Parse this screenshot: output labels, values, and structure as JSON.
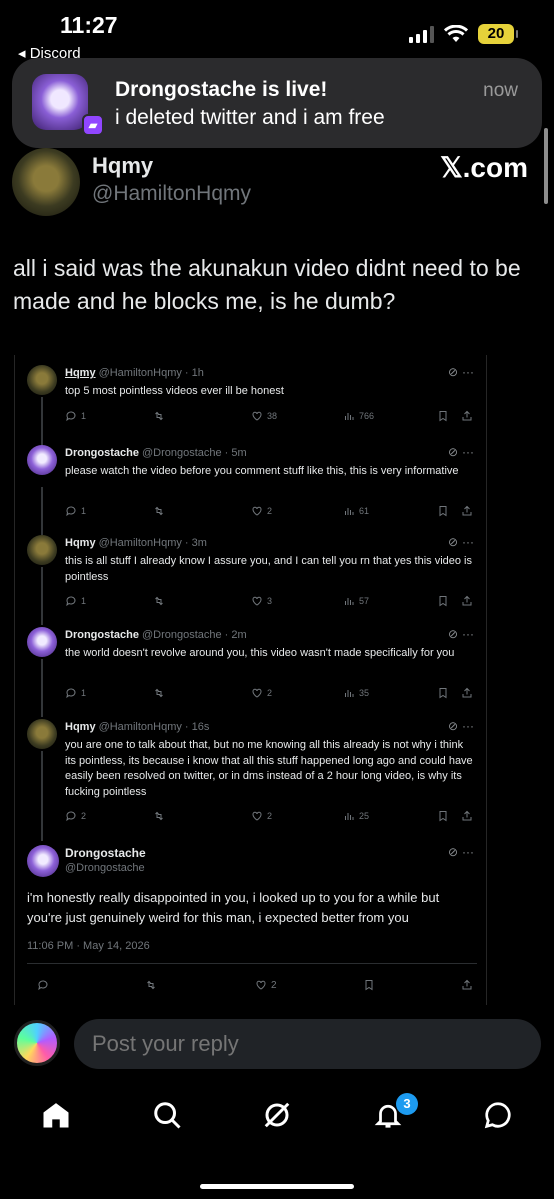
{
  "status_bar": {
    "time": "11:27",
    "back_app": "◂ Discord",
    "battery": "20"
  },
  "notification": {
    "title": "Drongostache is live!",
    "body": "i deleted twitter and i am free",
    "time": "now"
  },
  "post": {
    "author_name": "Hqmy",
    "author_handle": "@HamiltonHqmy",
    "source": "𝕏.com",
    "text": "all i said was the akunakun video didnt need to be made and he blocks me, is he dumb?"
  },
  "embedded_thread": {
    "tweets": [
      {
        "name": "Hqmy",
        "handle": "@HamiltonHqmy · 1h",
        "text": "top 5 most pointless videos ever ill be honest",
        "replies": "1",
        "retweets": "",
        "likes": "38",
        "views": "766"
      },
      {
        "name": "Drongostache",
        "handle": "@Drongostache · 5m",
        "text": "please watch the video before you comment stuff like this, this is very informative",
        "replies": "1",
        "retweets": "",
        "likes": "2",
        "views": "61"
      },
      {
        "name": "Hqmy",
        "handle": "@HamiltonHqmy · 3m",
        "text": "this is all stuff I already know I assure you, and I can tell you rn that yes this video is pointless",
        "replies": "1",
        "retweets": "",
        "likes": "3",
        "views": "57"
      },
      {
        "name": "Drongostache",
        "handle": "@Drongostache · 2m",
        "text": "the world doesn't revolve around you, this video wasn't made specifically for you",
        "replies": "1",
        "retweets": "",
        "likes": "2",
        "views": "35"
      },
      {
        "name": "Hqmy",
        "handle": "@HamiltonHqmy · 16s",
        "text": "you are one to talk about that, but no me knowing all this already is not why i think its pointless, its because i know that all this stuff happened long ago and could have easily been resolved on twitter, or in dms instead of a 2 hour long video, is why its fucking pointless",
        "replies": "2",
        "retweets": "",
        "likes": "2",
        "views": "25"
      }
    ],
    "final_tweet": {
      "name": "Drongostache",
      "handle": "@Drongostache",
      "text": "i'm honestly really disappointed in you, i looked up to you for a while but you're just genuinely weird for this man, i expected better from you",
      "timestamp": "11:06 PM · May 14, 2026",
      "likes": "2"
    }
  },
  "reply_bar": {
    "placeholder": "Post your reply"
  },
  "bottom_nav": {
    "notification_count": "3"
  },
  "colors": {
    "accent": "#1d9bf0",
    "background": "#000000",
    "secondary_text": "#71767b",
    "twitch": "#9146ff",
    "battery": "#e6d23a"
  }
}
